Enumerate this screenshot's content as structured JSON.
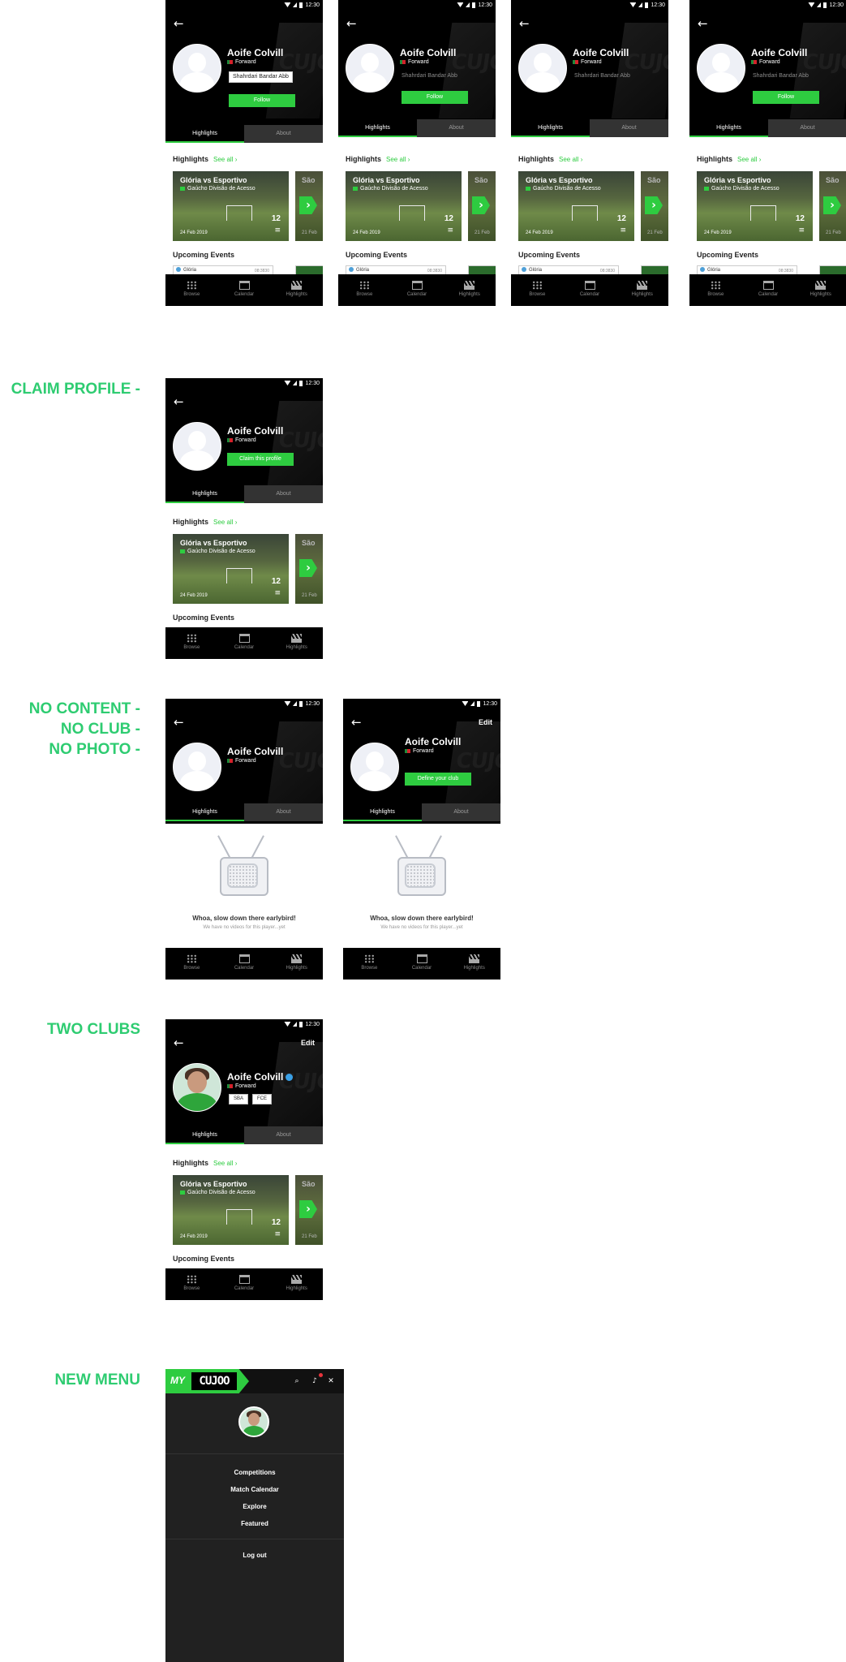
{
  "status": {
    "time": "12:30"
  },
  "profile": {
    "name": "Aoife Colvill",
    "position": "Forward",
    "club": "Shahrdari Bandar Abb",
    "follow_label": "Follow",
    "claim_label": "Claim this profile",
    "define_club_label": "Define your club",
    "edit_label": "Edit",
    "clubs": [
      "SBA",
      "FCE"
    ],
    "watermark": "CUJOO"
  },
  "tabs": {
    "highlights": "Highlights",
    "about": "About"
  },
  "highlights": {
    "title": "Highlights",
    "see_all": "See all",
    "card1": {
      "title": "Glória vs Esportivo",
      "competition": "Gaúcho Divisão de Acesso",
      "date": "24 Feb 2019",
      "count": "12"
    },
    "card2": {
      "title": "São",
      "date": "21 Feb"
    }
  },
  "upcoming": {
    "title": "Upcoming Events",
    "team": "Glória",
    "time": "08:3830"
  },
  "bottom_nav": {
    "browse": "Browse",
    "calendar": "Calendar",
    "highlights": "Highlights"
  },
  "labels": {
    "claim": "CLAIM PROFILE -",
    "no_content": "NO CONTENT -",
    "no_club": "NO CLUB -",
    "no_photo": "NO PHOTO -",
    "two_clubs": "TWO CLUBS",
    "new_menu": "NEW MENU"
  },
  "empty": {
    "title": "Whoa, slow down there earlybird!",
    "subtitle": "We have no videos for this player...yet"
  },
  "menu": {
    "logo_my": "MY",
    "logo_cujoo": "CUJOO",
    "items": [
      "Competitions",
      "Match Calendar",
      "Explore",
      "Featured"
    ],
    "logout": "Log out"
  },
  "colors": {
    "accent": "#2ecc40",
    "label": "#2ecc71",
    "dark": "#000000",
    "menu_bg": "#212121"
  }
}
